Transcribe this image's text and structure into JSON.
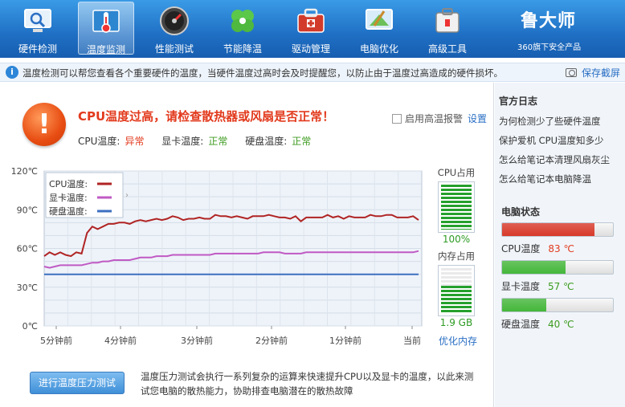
{
  "nav": [
    {
      "label": "硬件检测",
      "icon": "monitor-search-icon"
    },
    {
      "label": "温度监测",
      "icon": "thermometer-icon"
    },
    {
      "label": "性能测试",
      "icon": "speedometer-icon"
    },
    {
      "label": "节能降温",
      "icon": "clover-icon"
    },
    {
      "label": "驱动管理",
      "icon": "toolbox-icon"
    },
    {
      "label": "电脑优化",
      "icon": "screen-broom-icon"
    },
    {
      "label": "高级工具",
      "icon": "tool-case-icon"
    }
  ],
  "brand": {
    "name": "鲁大师",
    "sub": "360旗下安全产品"
  },
  "info": {
    "text": "温度检测可以帮您查看各个重要硬件的温度，当硬件温度过高时会及时提醒您，以防止由于温度过高造成的硬件损坏。",
    "save": "保存截屏"
  },
  "alert": {
    "title": "CPU温度过高，请检查散热器或风扇是否正常！",
    "cpu_label": "CPU温度:",
    "cpu_status": "异常",
    "gpu_label": "显卡温度:",
    "gpu_status": "正常",
    "disk_label": "硬盘温度:",
    "disk_status": "正常",
    "alarm_label": "启用高温报警",
    "settings": "设置"
  },
  "chart_data": {
    "type": "line",
    "yticks": [
      "120℃",
      "90℃",
      "60℃",
      "30℃",
      "0℃"
    ],
    "ylim": [
      0,
      120
    ],
    "xticks": [
      "5分钟前",
      "4分钟前",
      "3分钟前",
      "2分钟前",
      "1分钟前",
      "当前"
    ],
    "series": [
      {
        "name": "CPU温度:",
        "color": "#b02424",
        "values": [
          54,
          57,
          55,
          57,
          55,
          54,
          57,
          56,
          72,
          77,
          75,
          77,
          79,
          79,
          80,
          80,
          79,
          81,
          82,
          81,
          82,
          83,
          82,
          83,
          85,
          84,
          82,
          83,
          83,
          84,
          83,
          83,
          86,
          85,
          85,
          84,
          85,
          84,
          83,
          85,
          85,
          85,
          86,
          85,
          84,
          84,
          83,
          85,
          81,
          84,
          84,
          84,
          84,
          86,
          84,
          85,
          83,
          85,
          84,
          84,
          84,
          86,
          85,
          85,
          86,
          86,
          84,
          84,
          84,
          85,
          82
        ]
      },
      {
        "name": "显卡温度:",
        "color": "#c05ac4",
        "values": [
          46,
          45,
          46,
          47,
          47,
          47,
          47,
          47,
          48,
          49,
          49,
          50,
          50,
          51,
          51,
          51,
          51,
          52,
          53,
          53,
          53,
          54,
          54,
          54,
          55,
          55,
          55,
          55,
          55,
          55,
          55,
          55,
          56,
          56,
          56,
          56,
          56,
          56,
          56,
          56,
          56,
          57,
          57,
          57,
          57,
          56,
          56,
          56,
          56,
          57,
          57,
          57,
          57,
          57,
          57,
          57,
          57,
          57,
          57,
          57,
          57,
          57,
          57,
          57,
          57,
          57,
          57,
          57,
          57,
          57,
          58
        ]
      },
      {
        "name": "硬盘温度:",
        "color": "#3d6fc0",
        "values": [
          40,
          40,
          40,
          40,
          40,
          40,
          40,
          40,
          40,
          40,
          40,
          40,
          40,
          40,
          40,
          40,
          40,
          40,
          40,
          40,
          40,
          40,
          40,
          40,
          40,
          40,
          40,
          40,
          40,
          40,
          40,
          40,
          40,
          40,
          40,
          40,
          40,
          40,
          40,
          40,
          40,
          40,
          40,
          40,
          40,
          40,
          40,
          40,
          40,
          40,
          40,
          40,
          40,
          40,
          40,
          40,
          40,
          40,
          40,
          40,
          40,
          40,
          40,
          40,
          40,
          40,
          40,
          40,
          40,
          40,
          40
        ]
      }
    ],
    "legend": "top-left",
    "grid": true
  },
  "cpu_usage": {
    "title": "CPU占用",
    "value": "100%",
    "fraction": 1.0
  },
  "mem_usage": {
    "title": "内存占用",
    "value": "1.9 GB",
    "fraction": 0.6
  },
  "optimize": "优化内存",
  "test": {
    "button": "进行温度压力测试",
    "desc": "温度压力测试会执行一系列复杂的运算来快速提升CPU以及显卡的温度，以此来测试您电脑的散热能力，协助排查电脑潜在的散热故障"
  },
  "side": {
    "log_title": "官方日志",
    "logs": [
      "为何检测少了些硬件温度",
      "保护爱机 CPU温度知多少",
      "怎么给笔记本清理风扇灰尘",
      "怎么给笔记本电脑降温"
    ],
    "status_title": "电脑状态",
    "items": [
      {
        "label": "CPU温度",
        "value": "83 ℃",
        "fraction": 0.83,
        "color": "#d93a2a",
        "vcolor": "#e23a1d"
      },
      {
        "label": "显卡温度",
        "value": "57 ℃",
        "fraction": 0.57,
        "color": "#45b83b",
        "vcolor": "#3c9b1f"
      },
      {
        "label": "硬盘温度",
        "value": "40 ℃",
        "fraction": 0.4,
        "color": "#45b83b",
        "vcolor": "#3c9b1f"
      }
    ]
  }
}
